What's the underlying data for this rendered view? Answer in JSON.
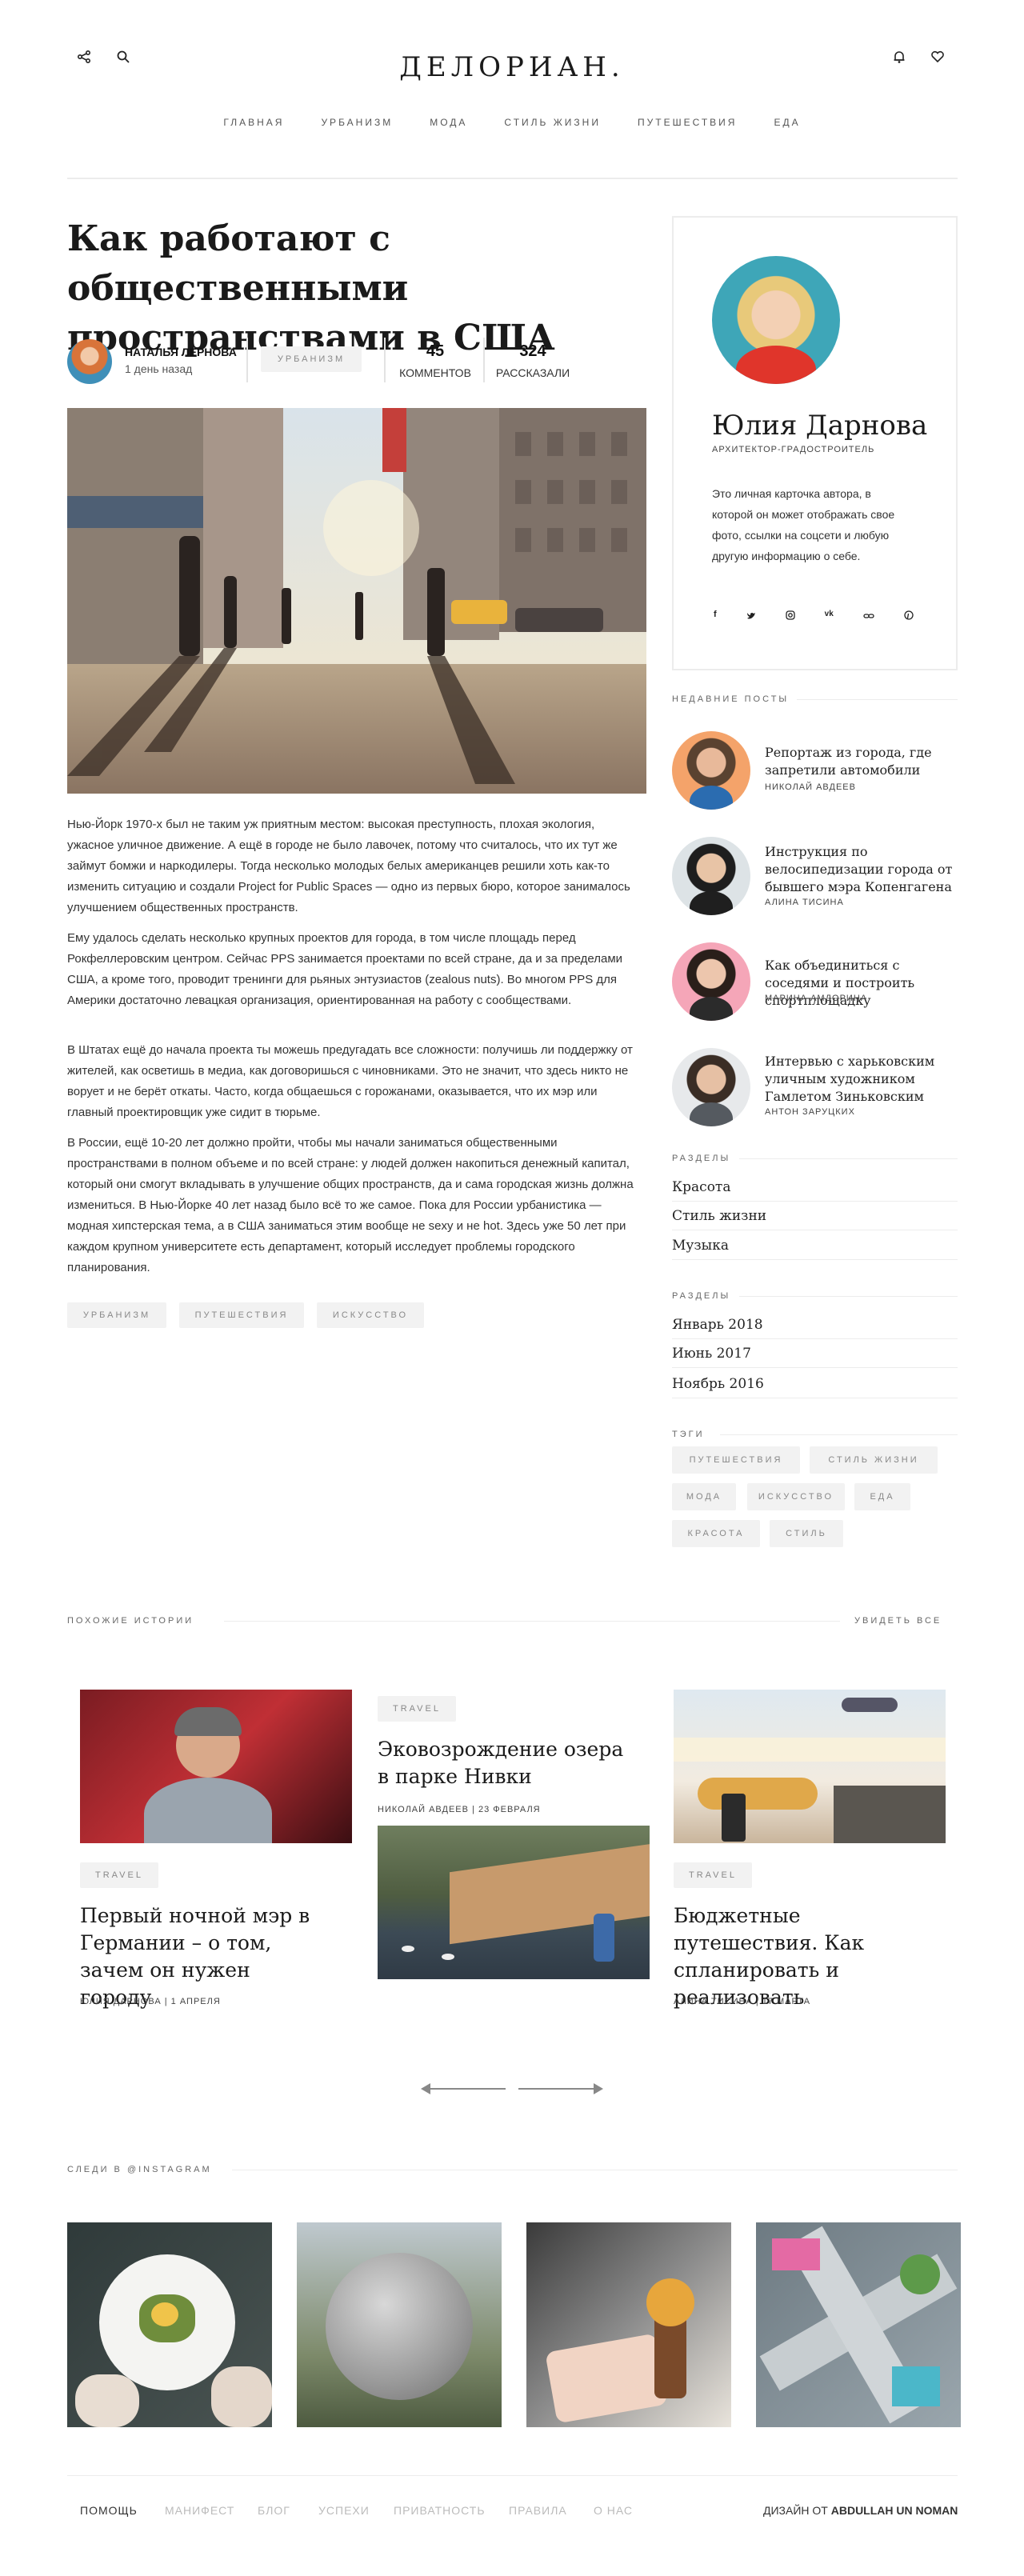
{
  "header": {
    "logo": "ДЕЛОРИАН.",
    "nav": [
      "ГЛАВНАЯ",
      "УРБАНИЗМ",
      "МОДА",
      "СТИЛЬ ЖИЗНИ",
      "ПУТЕШЕСТВИЯ",
      "ЕДА"
    ]
  },
  "article": {
    "title": "Как работают с общественными пространствами в США",
    "author": "НАТАЛЬЯ ЛЕРНОВА",
    "date": "1 день назад",
    "category": "УРБАНИЗМ",
    "comments_count": "45",
    "comments_label": "КОММЕНТОВ",
    "shares_count": "324",
    "shares_label": "РАССКАЗАЛИ",
    "paragraphs": [
      "Нью-Йорк 1970-х был не таким уж приятным местом: высокая преступность, плохая экология, ужасное уличное движение. А ещё в городе не было лавочек, потому что считалось, что их тут же займут бомжи и наркодилеры. Тогда несколько молодых белых американцев решили хоть как-то изменить ситуацию и создали Project for Public Spaces — одно из первых бюро, которое занималось улучшением общественных пространств.",
      "Ему удалось сделать несколько крупных проектов для города, в том числе площадь перед Рокфеллеровским центром. Сейчас PPS занимается проектами по всей стране, да и за пределами США, а кроме того, проводит тренинги для рьяных энтузиастов (zealous nuts). Во многом PPS для Америки достаточно левацкая организация, ориентированная на работу с сообществами.",
      "В Штатах ещё до начала проекта ты можешь предугадать все сложности: получишь ли поддержку от жителей, как осветишь в медиа, как договоришься с чиновниками. Это не значит, что здесь никто не ворует и не берёт откаты. Часто, когда общаешься с горожанами, оказывается, что их мэр или главный проектировщик уже сидит в тюрьме.",
      "В России, ещё 10-20 лет должно пройти, чтобы мы начали заниматься общественными пространствами в полном объеме и по всей стране: у людей должен накопиться денежный капитал, который они смогут вкладывать в улучшение общих пространств, да и сама городская жизнь должна измениться. В Нью-Йорке 40 лет назад было всё то же самое. Пока для России урбанистика — модная хипстерская тема, а в США заниматься этим вообще не sexy и не hot. Здесь уже 50 лет при каждом крупном университете есть департамент, который исследует проблемы городского планирования."
    ],
    "tags": [
      "УРБАНИЗМ",
      "ПУТЕШЕСТВИЯ",
      "ИСКУССТВО"
    ]
  },
  "author_card": {
    "name": "Юлия Дарнова",
    "role": "АРХИТЕКТОР-ГРАДОСТРОИТЕЛЬ",
    "bio": "Это личная карточка автора, в которой он может отображать свое фото, ссылки на соцсети и любую другую информацию о себе."
  },
  "recent": {
    "heading": "НЕДАВНИЕ ПОСТЫ",
    "posts": [
      {
        "title": "Репортаж из города, где запретили автомобили",
        "author": "НИКОЛАЙ АВДЕЕВ"
      },
      {
        "title": "Инструкция по велосипедизации города от бывшего мэра Копенгагена",
        "author": "АЛИНА ТИСИНА"
      },
      {
        "title": "Как объединиться с соседями и построить спортплощадку",
        "author": "МАРИНА АМДОРИНА"
      },
      {
        "title": "Интервью с харьковским уличным художником Гамлетом Зиньковским",
        "author": "АНТОН ЗАРУЦКИХ"
      }
    ]
  },
  "sections": {
    "heading": "РАЗДЕЛЫ",
    "items": [
      "Красота",
      "Стиль жизни",
      "Музыка"
    ]
  },
  "archive": {
    "heading": "РАЗДЕЛЫ",
    "items": [
      "Январь 2018",
      "Июнь 2017",
      "Ноябрь 2016"
    ]
  },
  "tags_widget": {
    "heading": "ТЭГИ",
    "items": [
      "ПУТЕШЕСТВИЯ",
      "СТИЛЬ ЖИЗНИ",
      "МОДА",
      "ИСКУССТВО",
      "ЕДА",
      "КРАСОТА",
      "СТИЛЬ"
    ]
  },
  "similar": {
    "heading": "ПОХОЖИЕ ИСТОРИИ",
    "see_all": "УВИДЕТЬ ВСЕ",
    "stories": [
      {
        "tag": "TRAVEL",
        "title": "Первый ночной мэр в Германии – о том, зачем он нужен городу",
        "meta": "ЮЛИЯ ДАРНОВА | 1 АПРЕЛЯ"
      },
      {
        "tag": "TRAVEL",
        "title": "Эковозрождение озера в парке Нивки",
        "meta": "НИКОЛАЙ АВДЕЕВ | 23 ФЕВРАЛЯ"
      },
      {
        "tag": "TRAVEL",
        "title": "Бюджетные путешествия. Как спланировать и реализовать",
        "meta": "АЛИНА ТИСИНА | 17 МАРТА"
      }
    ]
  },
  "instagram": {
    "heading": "СЛЕДИ В @INSTAGRAM"
  },
  "footer": {
    "links": [
      "ПОМОЩЬ",
      "МАНИФЕСТ",
      "БЛОГ",
      "УСПЕХИ",
      "ПРИВАТНОСТЬ",
      "ПРАВИЛА",
      "О НАС"
    ],
    "credit_prefix": "ДИЗАЙН ОТ",
    "credit_name": "ABDULLAH UN NOMAN"
  }
}
